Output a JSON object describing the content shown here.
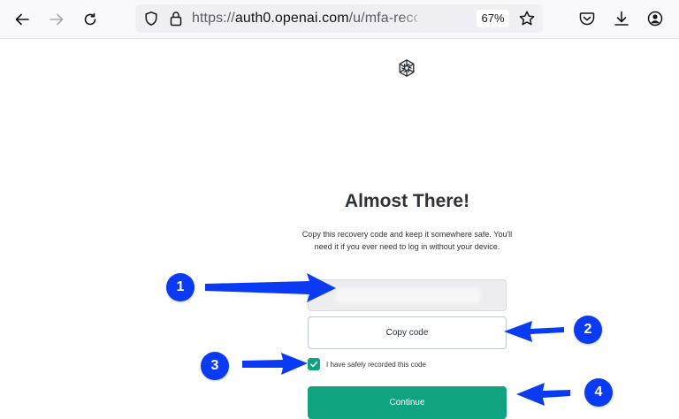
{
  "browser": {
    "url_scheme": "https://",
    "url_host": "auth0.openai.com",
    "url_path": "/u/mfa-recovery-code-",
    "zoom": "67%",
    "icons": [
      "back-arrow-icon",
      "forward-arrow-icon",
      "reload-icon",
      "shield-icon",
      "lock-icon",
      "star-icon",
      "pocket-icon",
      "download-icon",
      "account-icon"
    ]
  },
  "page": {
    "logo_icon": "openai-logo-icon",
    "title": "Almost There!",
    "description": "Copy this recovery code and keep it somewhere safe. You'll need it if you ever need to log in without your device.",
    "copy_button": "Copy code",
    "checkbox_label": "I have safely recorded this code",
    "checkbox_checked": true,
    "continue_button": "Continue"
  },
  "annotations": {
    "badges": [
      "1",
      "2",
      "3",
      "4"
    ],
    "color": "#0a3bf2"
  },
  "colors": {
    "accent": "#10a37f",
    "annotation": "#0a3bf2"
  }
}
